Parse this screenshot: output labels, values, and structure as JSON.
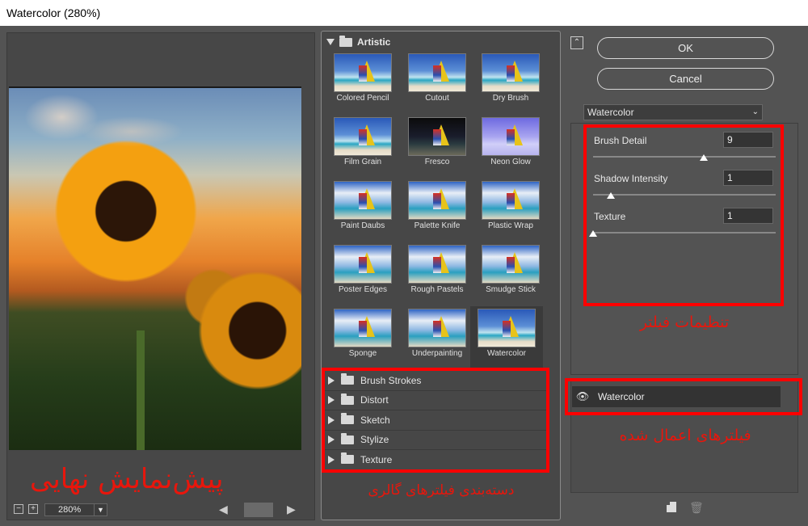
{
  "window": {
    "title": "Watercolor (280%)"
  },
  "preview": {
    "label": "پیش‌نمایش نهایی",
    "zoom": "280%",
    "zoom_out": "−",
    "zoom_in": "+",
    "nav_left": "◀",
    "nav_right": "▶"
  },
  "gallery": {
    "category": "Artistic",
    "filters": [
      {
        "label": "Colored Pencil"
      },
      {
        "label": "Cutout"
      },
      {
        "label": "Dry Brush"
      },
      {
        "label": "Film Grain"
      },
      {
        "label": "Fresco"
      },
      {
        "label": "Neon Glow"
      },
      {
        "label": "Paint Daubs"
      },
      {
        "label": "Palette Knife"
      },
      {
        "label": "Plastic Wrap"
      },
      {
        "label": "Poster Edges"
      },
      {
        "label": "Rough Pastels"
      },
      {
        "label": "Smudge Stick"
      },
      {
        "label": "Sponge"
      },
      {
        "label": "Underpainting"
      },
      {
        "label": "Watercolor"
      }
    ],
    "selected_filter": "Watercolor",
    "categories": [
      "Brush Strokes",
      "Distort",
      "Sketch",
      "Stylize",
      "Texture"
    ],
    "categories_label": "دسته‌بندی فیلترهای گالری"
  },
  "buttons": {
    "ok": "OK",
    "cancel": "Cancel",
    "collapse": "⌃"
  },
  "settings": {
    "selected_filter": "Watercolor",
    "brush_detail": {
      "label": "Brush Detail",
      "value": "9",
      "level": 0.6
    },
    "shadow_intensity": {
      "label": "Shadow Intensity",
      "value": "1",
      "level": 0.1
    },
    "texture": {
      "label": "Texture",
      "value": "1",
      "level": 0.0
    },
    "label": "تنظیمات فیلتر"
  },
  "layers": {
    "items": [
      {
        "name": "Watercolor",
        "visible": true
      }
    ],
    "label": "فیلترهای اعمال شده"
  },
  "colors": {
    "annotation_red": "#ff0000",
    "panel_bg": "#535353"
  }
}
